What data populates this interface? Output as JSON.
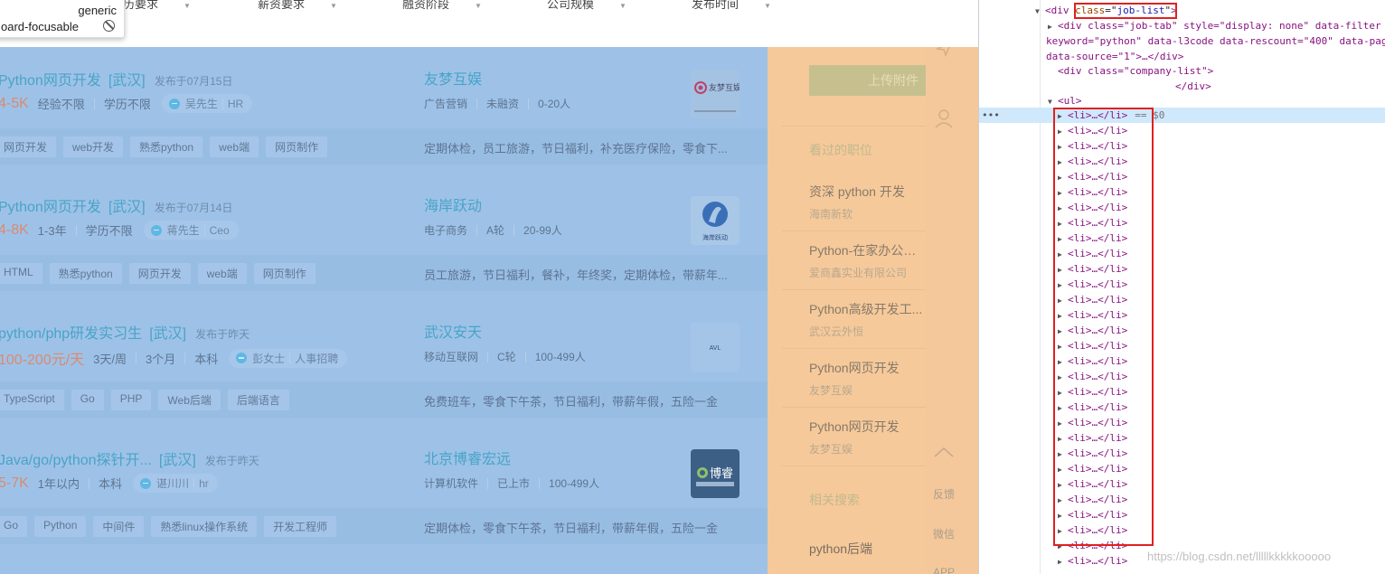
{
  "filters": [
    "历要求",
    "薪资要求",
    "融资阶段",
    "公司规模",
    "发布时间"
  ],
  "tooltip": {
    "role": "generic",
    "label": "oard-focusable"
  },
  "jobs": [
    {
      "title": "Python网页开发",
      "area": "[武汉]",
      "published": "发布于07月15日",
      "salary": "4-5K",
      "meta": [
        "经验不限",
        "学历不限"
      ],
      "recruiter": "吴先生",
      "recruiter_role": "HR",
      "company": "友梦互娱",
      "company_meta": [
        "广告营销",
        "未融资",
        "0-20人"
      ],
      "tags": [
        "网页开发",
        "web开发",
        "熟悉python",
        "web端",
        "网页制作"
      ],
      "welfare": "定期体检，员工旅游，节日福利，补充医疗保险，零食下...",
      "logo_text": "友梦互娱"
    },
    {
      "title": "Python网页开发",
      "area": "[武汉]",
      "published": "发布于07月14日",
      "salary": "4-8K",
      "meta": [
        "1-3年",
        "学历不限"
      ],
      "recruiter": "蒋先生",
      "recruiter_role": "Ceo",
      "company": "海岸跃动",
      "company_meta": [
        "电子商务",
        "A轮",
        "20-99人"
      ],
      "tags": [
        "HTML",
        "熟悉python",
        "网页开发",
        "web端",
        "网页制作"
      ],
      "welfare": "员工旅游，节日福利，餐补，年终奖，定期体检，带薪年...",
      "logo_text": "海岸跃动"
    },
    {
      "title": "python/php研发实习生",
      "area": "[武汉]",
      "published": "发布于昨天",
      "salary": "100-200元/天",
      "meta": [
        "3天/周",
        "3个月",
        "本科"
      ],
      "recruiter": "彭女士",
      "recruiter_role": "人事招聘",
      "company": "武汉安天",
      "company_meta": [
        "移动互联网",
        "C轮",
        "100-499人"
      ],
      "tags": [
        "TypeScript",
        "Go",
        "PHP",
        "Web后端",
        "后端语言"
      ],
      "welfare": "免费班车，零食下午茶，节日福利，带薪年假，五险一金",
      "logo_text": "AVL"
    },
    {
      "title": "Java/go/python探针开...",
      "area": "[武汉]",
      "published": "发布于昨天",
      "salary": "5-7K",
      "meta": [
        "1年以内",
        "本科"
      ],
      "recruiter": "谌川川",
      "recruiter_role": "hr",
      "company": "北京博睿宏远",
      "company_meta": [
        "计算机软件",
        "已上市",
        "100-499人"
      ],
      "tags": [
        "Go",
        "Python",
        "中间件",
        "熟悉linux操作系统",
        "开发工程师"
      ],
      "welfare": "定期体检，零食下午茶，节日福利，带薪年假，五险一金",
      "logo_text": "博睿"
    }
  ],
  "side": {
    "upload_label": "上传附件",
    "viewed_title": "看过的职位",
    "viewed": [
      {
        "title": "资深 python 开发",
        "company": "海南新软"
      },
      {
        "title": "Python-在家办公即可",
        "company": "爱商鑫实业有限公司"
      },
      {
        "title": "Python高级开发工...",
        "company": "武汉云外恒"
      },
      {
        "title": "Python网页开发",
        "company": "友梦互娱"
      },
      {
        "title": "Python网页开发",
        "company": "友梦互娱"
      }
    ],
    "related_title": "相关搜索",
    "related_first": "python后端",
    "tools": {
      "feedback": "反馈",
      "wechat": "微信",
      "app": "APP"
    }
  },
  "devtools": {
    "job_list_div": {
      "tag": "div",
      "attr": "class",
      "value": "job-list"
    },
    "job_tab_line1_pre": "<div class=\"job-tab\" style=\"display: none\" data-filter c",
    "job_tab_line2": "keyword=\"python\" data-l3code data-rescount=\"400\" data-pag",
    "job_tab_line3": "data-source=\"1\">…</div>",
    "company_list_open": "<div class=\"company-list\">",
    "company_list_close": "</div>",
    "ul_open": "<ul>",
    "li_item": "<li>…</li>",
    "selected_suffix": "== $0",
    "li_count": 30,
    "watermark": "https://blog.csdn.net/lllllkkkkkooooo"
  }
}
